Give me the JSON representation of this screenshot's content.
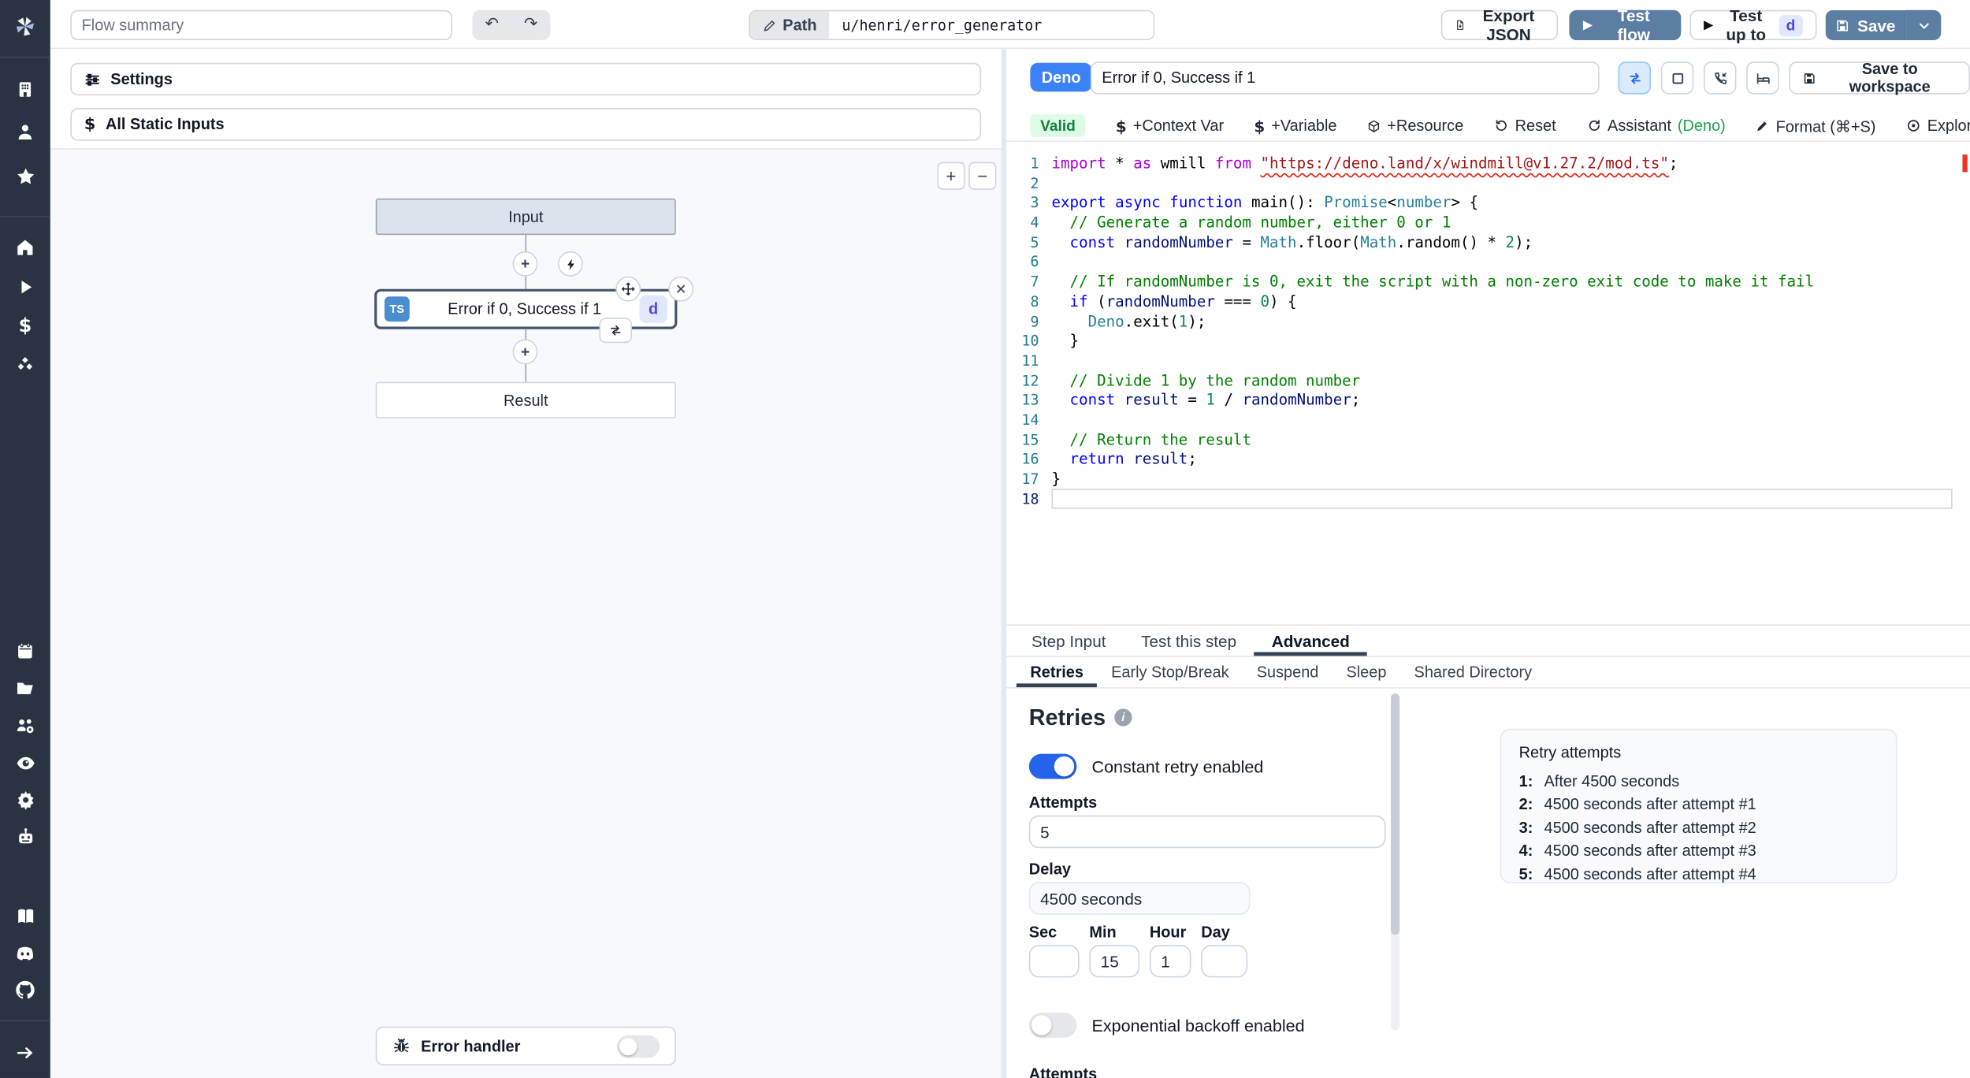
{
  "topbar": {
    "flow_summary_placeholder": "Flow summary",
    "undo": "↶",
    "redo": "↷",
    "path_label": "Path",
    "path_value": "u/henri/error_generator",
    "export_json": "Export JSON",
    "test_flow": "Test flow",
    "test_up_to": "Test up to",
    "test_up_to_badge": "d",
    "save": "Save"
  },
  "sidebar": {
    "icons": [
      "windmill-logo",
      "workspace",
      "user",
      "favorites",
      "home",
      "runs",
      "variables",
      "resources",
      "schedules",
      "folders",
      "groups",
      "audit-logs",
      "settings",
      "workers",
      "docs",
      "discord",
      "github",
      "expand"
    ]
  },
  "left": {
    "settings": "Settings",
    "all_static_inputs": "All Static Inputs",
    "zoom_in": "+",
    "zoom_out": "−",
    "graph": {
      "input_node": "Input",
      "step_lang_badge": "TS",
      "step_label": "Error if 0, Success if 1",
      "step_id_badge": "d",
      "result_node": "Result",
      "error_handler": "Error handler"
    }
  },
  "step": {
    "lang_badge": "Deno",
    "summary_value": "Error if 0, Success if 1",
    "save_to_workspace": "Save to workspace",
    "toolbar": {
      "valid": "Valid",
      "context_var": "+Context Var",
      "variable": "+Variable",
      "resource": "+Resource",
      "reset": "Reset",
      "assistant": "Assistant ",
      "assistant_lang": "(Deno)",
      "format": "Format (⌘+S)",
      "explore": "Explore other s"
    }
  },
  "editor": {
    "current_line": 18,
    "lines": [
      [
        [
          "kp",
          "import"
        ],
        [
          "p",
          " * "
        ],
        [
          "kp",
          "as"
        ],
        [
          "p",
          " wmill "
        ],
        [
          "kp",
          "from"
        ],
        [
          "p",
          " "
        ],
        [
          "s sq",
          "\"https://deno.land/x/windmill@v1.27.2/mod.ts\""
        ],
        [
          "p",
          ";"
        ]
      ],
      [],
      [
        [
          "k",
          "export"
        ],
        [
          "p",
          " "
        ],
        [
          "k",
          "async"
        ],
        [
          "p",
          " "
        ],
        [
          "k",
          "function"
        ],
        [
          "p",
          " main(): "
        ],
        [
          "t",
          "Promise"
        ],
        [
          "p",
          "<"
        ],
        [
          "t",
          "number"
        ],
        [
          "p",
          "> {"
        ]
      ],
      [
        [
          "c",
          "  // Generate a random number, either 0 or 1"
        ]
      ],
      [
        [
          "p",
          "  "
        ],
        [
          "k",
          "const"
        ],
        [
          "p",
          " "
        ],
        [
          "v",
          "randomNumber"
        ],
        [
          "p",
          " = "
        ],
        [
          "t",
          "Math"
        ],
        [
          "p",
          ".floor("
        ],
        [
          "t",
          "Math"
        ],
        [
          "p",
          ".random() * "
        ],
        [
          "n",
          "2"
        ],
        [
          "p",
          ");"
        ]
      ],
      [],
      [
        [
          "c",
          "  // If randomNumber is 0, exit the script with a non-zero exit code to make it fail"
        ]
      ],
      [
        [
          "p",
          "  "
        ],
        [
          "k",
          "if"
        ],
        [
          "p",
          " ("
        ],
        [
          "v",
          "randomNumber"
        ],
        [
          "p",
          " === "
        ],
        [
          "n",
          "0"
        ],
        [
          "p",
          ") {"
        ]
      ],
      [
        [
          "p",
          "    "
        ],
        [
          "t",
          "Deno"
        ],
        [
          "p",
          ".exit("
        ],
        [
          "n",
          "1"
        ],
        [
          "p",
          ");"
        ]
      ],
      [
        [
          "p",
          "  }"
        ]
      ],
      [],
      [
        [
          "c",
          "  // Divide 1 by the random number"
        ]
      ],
      [
        [
          "p",
          "  "
        ],
        [
          "k",
          "const"
        ],
        [
          "p",
          " "
        ],
        [
          "v",
          "result"
        ],
        [
          "p",
          " = "
        ],
        [
          "n",
          "1"
        ],
        [
          "p",
          " / "
        ],
        [
          "v",
          "randomNumber"
        ],
        [
          "p",
          ";"
        ]
      ],
      [],
      [
        [
          "c",
          "  // Return the result"
        ]
      ],
      [
        [
          "p",
          "  "
        ],
        [
          "k",
          "return"
        ],
        [
          "p",
          " "
        ],
        [
          "v",
          "result"
        ],
        [
          "p",
          ";"
        ]
      ],
      [
        [
          "p",
          "}"
        ]
      ],
      []
    ]
  },
  "tabs": {
    "step_input": "Step Input",
    "test_this_step": "Test this step",
    "advanced": "Advanced"
  },
  "subtabs": {
    "retries": "Retries",
    "early_stop": "Early Stop/Break",
    "suspend": "Suspend",
    "sleep": "Sleep",
    "shared_directory": "Shared Directory"
  },
  "retries": {
    "title": "Retries",
    "constant_toggle_label": "Constant retry enabled",
    "constant_toggle_on": true,
    "attempts_label": "Attempts",
    "attempts_value": "5",
    "delay_label": "Delay",
    "delay_value": "4500 seconds",
    "time_fields": [
      {
        "label": "Sec",
        "value": ""
      },
      {
        "label": "Min",
        "value": "15"
      },
      {
        "label": "Hour",
        "value": "1"
      },
      {
        "label": "Day",
        "value": ""
      }
    ],
    "exponential_toggle_label": "Exponential backoff enabled",
    "exponential_toggle_on": false,
    "next_section_label": "Attempts",
    "preview": {
      "title": "Retry attempts",
      "items": [
        {
          "n": "1:",
          "t": "After 4500 seconds"
        },
        {
          "n": "2:",
          "t": "4500 seconds after attempt #1"
        },
        {
          "n": "3:",
          "t": "4500 seconds after attempt #2"
        },
        {
          "n": "4:",
          "t": "4500 seconds after attempt #3"
        },
        {
          "n": "5:",
          "t": "4500 seconds after attempt #4"
        }
      ]
    }
  }
}
